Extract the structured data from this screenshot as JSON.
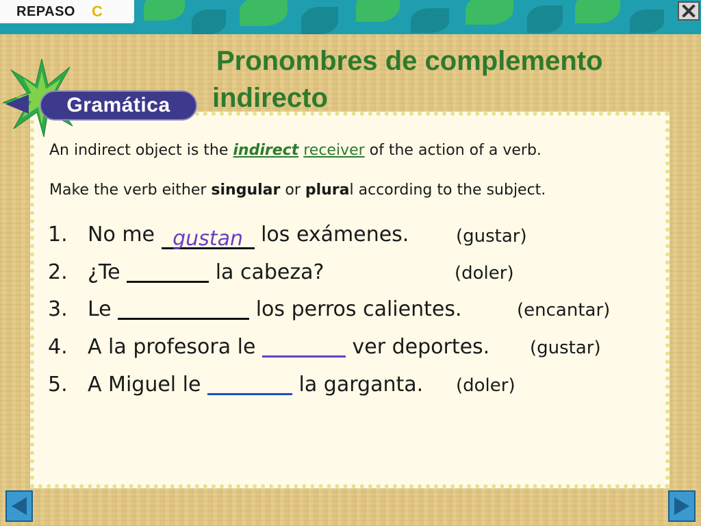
{
  "header": {
    "section_label": "REPASO",
    "section_letter": "C"
  },
  "title": {
    "line1": "Pronombres de complemento",
    "line2": "indirecto"
  },
  "badge": "Gramática",
  "intro": {
    "line1": {
      "before": "An indirect object is the ",
      "em": "indirect",
      "space": " ",
      "hl": "receiver",
      "after": " of the action of a verb."
    },
    "line2": {
      "before": "Make the verb either ",
      "bold1": "singular",
      "mid": " or ",
      "bold2": "plura",
      "after": "l according to the subject."
    }
  },
  "exercises": [
    {
      "num": "1.",
      "before": "No me ",
      "answer": "gustan",
      "after": " los exámenes.",
      "hint": "(gustar)"
    },
    {
      "num": "2.",
      "before": "¿Te ",
      "answer": "",
      "after": " la cabeza?",
      "hint": "(doler)"
    },
    {
      "num": "3.",
      "before": "Le ",
      "answer": "",
      "after": " los perros calientes.",
      "hint": "(encantar)"
    },
    {
      "num": "4.",
      "before": "A la profesora le ",
      "answer": "",
      "after": " ver deportes.",
      "hint": "(gustar)"
    },
    {
      "num": "5.",
      "before": "A Miguel le ",
      "answer": "",
      "after": " la garganta.",
      "hint": "(doler)"
    }
  ],
  "icons": {
    "close": "close-icon",
    "prev": "left-arrow-icon",
    "next": "right-arrow-icon"
  },
  "colors": {
    "title": "#2e7a2e",
    "banner": "#1f9eb0",
    "badge": "#3d3a8c",
    "answer": "#6a3fc0"
  }
}
